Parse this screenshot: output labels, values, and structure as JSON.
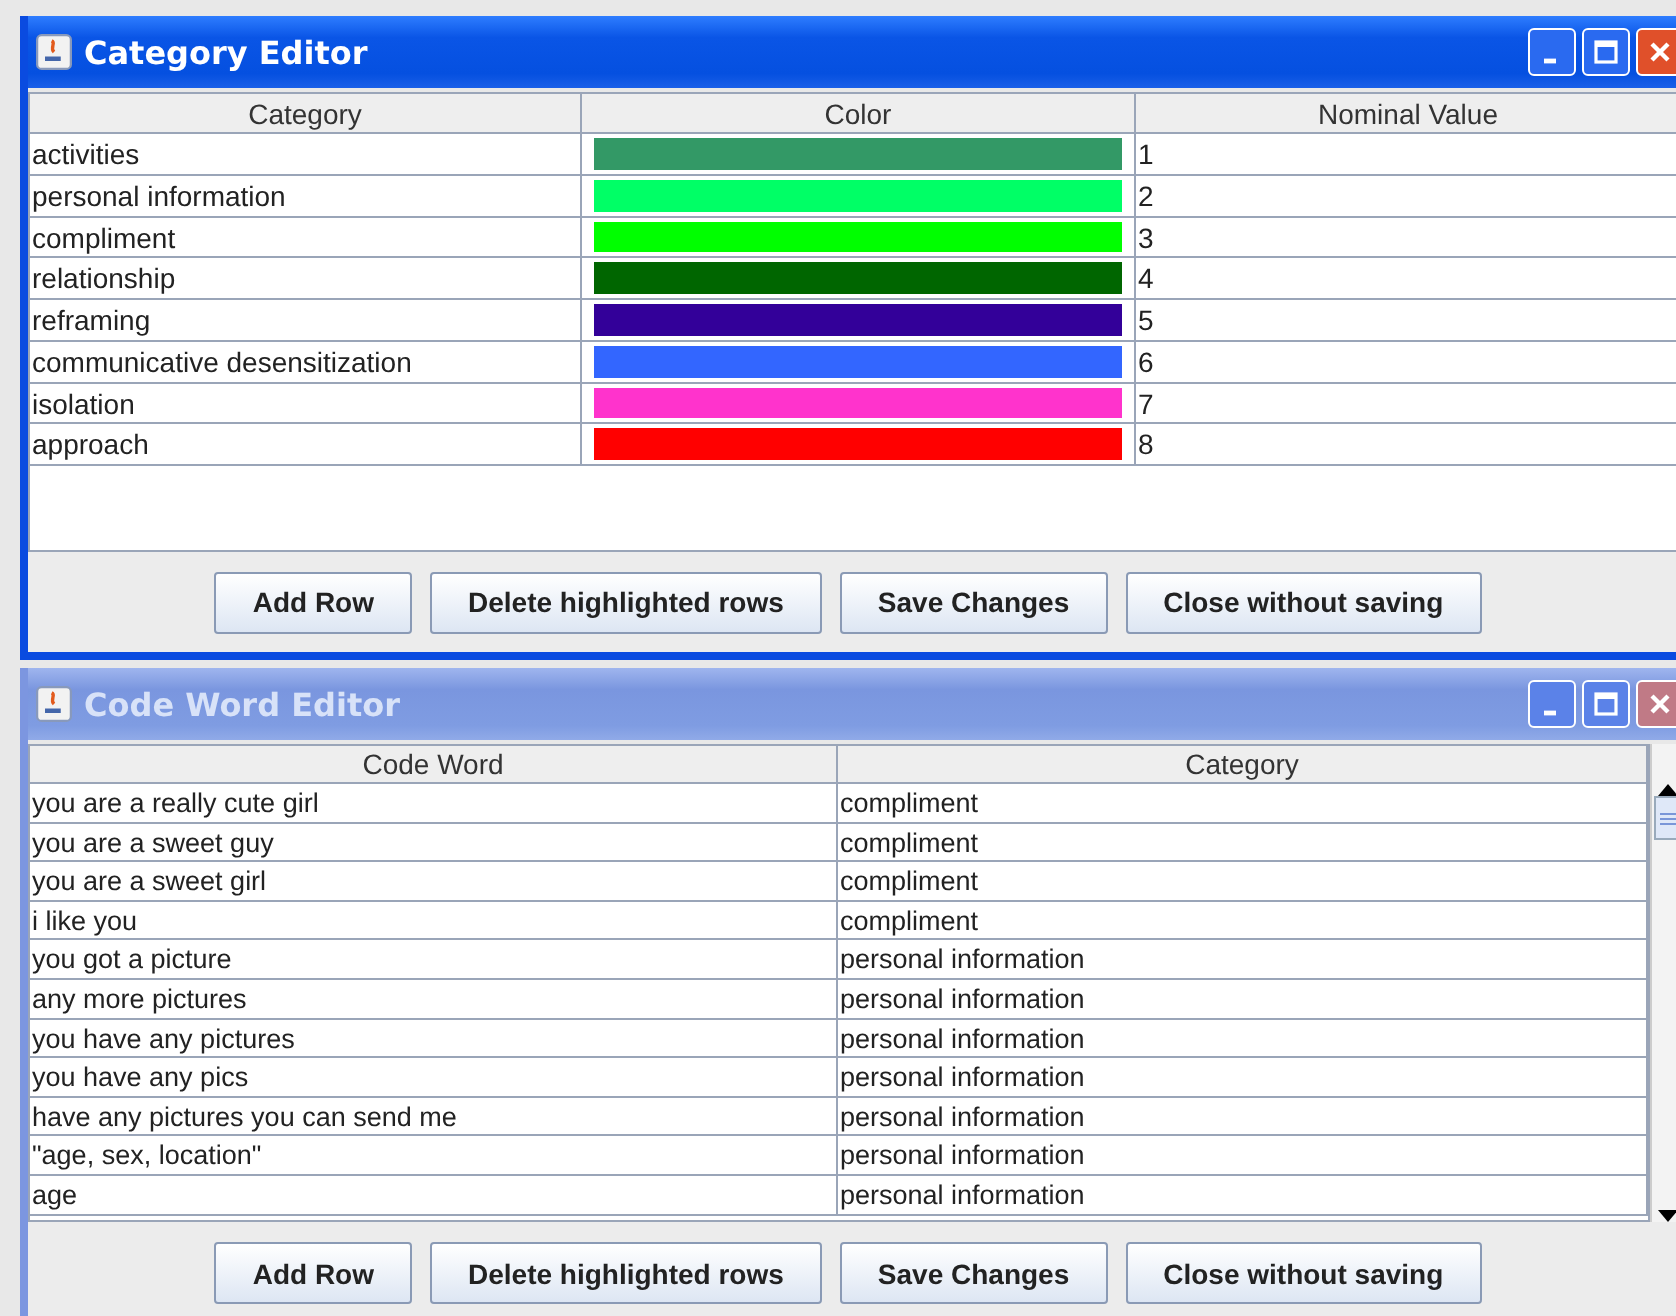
{
  "category_editor": {
    "title": "Category Editor",
    "active": true,
    "columns": [
      "Category",
      "Color",
      "Nominal Value"
    ],
    "rows": [
      {
        "category": "activities",
        "color": "#339966",
        "value": "1"
      },
      {
        "category": "personal information",
        "color": "#00ff66",
        "value": "2"
      },
      {
        "category": "compliment",
        "color": "#00ff00",
        "value": "3"
      },
      {
        "category": "relationship",
        "color": "#006600",
        "value": "4"
      },
      {
        "category": "reframing",
        "color": "#330099",
        "value": "5"
      },
      {
        "category": "communicative desensitization",
        "color": "#3366ff",
        "value": "6"
      },
      {
        "category": "isolation",
        "color": "#ff33cc",
        "value": "7"
      },
      {
        "category": "approach",
        "color": "#ff0000",
        "value": "8"
      }
    ],
    "buttons": [
      "Add Row",
      "Delete highlighted rows",
      "Save Changes",
      "Close without saving"
    ]
  },
  "code_word_editor": {
    "title": "Code Word Editor",
    "active": false,
    "columns": [
      "Code Word",
      "Category"
    ],
    "rows": [
      {
        "code_word": "you are a really cute girl",
        "category": "compliment"
      },
      {
        "code_word": "you are a sweet guy",
        "category": "compliment"
      },
      {
        "code_word": "you are a sweet girl",
        "category": "compliment"
      },
      {
        "code_word": "i like you",
        "category": "compliment"
      },
      {
        "code_word": "you got a picture",
        "category": "personal information"
      },
      {
        "code_word": "any more pictures",
        "category": "personal information"
      },
      {
        "code_word": "you have any pictures",
        "category": "personal information"
      },
      {
        "code_word": "you have any pics",
        "category": "personal information"
      },
      {
        "code_word": "have any pictures you can send me",
        "category": "personal information"
      },
      {
        "code_word": "\"age, sex, location\"",
        "category": "personal information"
      },
      {
        "code_word": "age",
        "category": "personal information"
      }
    ],
    "buttons": [
      "Add Row",
      "Delete highlighted rows",
      "Save Changes",
      "Close without saving"
    ]
  }
}
